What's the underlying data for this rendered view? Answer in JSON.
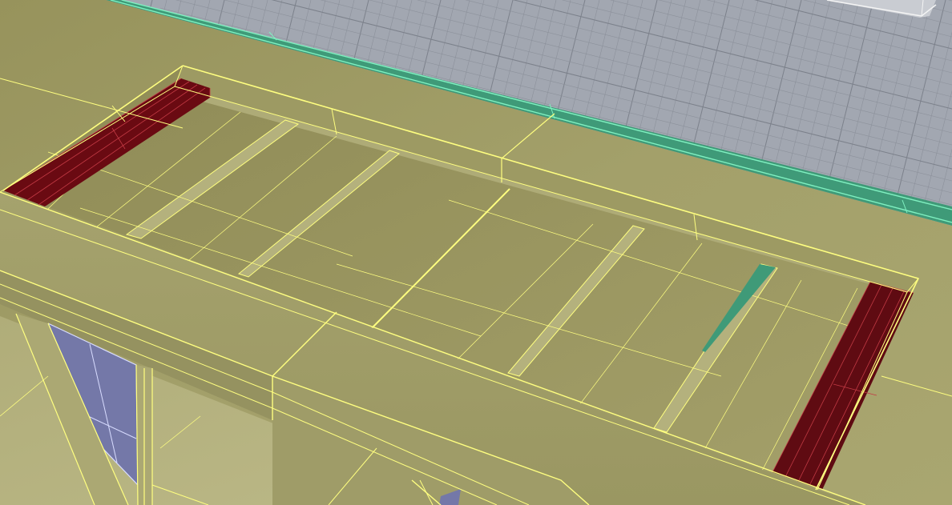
{
  "viewport": {
    "kind": "3d-modeling-viewport",
    "projection": "perspective",
    "display_mode": "shaded-with-wireframe-edges",
    "selection_state": "all-visible-geometry-selected"
  },
  "colors": {
    "ground_plane": "#a2a7b1",
    "grid_line": "#8c919b",
    "grid_major_line": "#7c818b",
    "selected_surface": "#a4a16a",
    "selected_surface_dark": "#8f8b57",
    "selected_surface_light": "#b4b17d",
    "selected_edge": "#ffff80",
    "highlight_face_red": "#6a0a12",
    "highlight_face_red_edge": "#c23a44",
    "glass_panel": "#7478a8",
    "glass_panel_edge": "#d8dcff",
    "teal_edge_strip": "#3f9a78",
    "teal_edge_line": "#7ff0c0",
    "background_object": "#c9ccd2"
  },
  "objects": [
    {
      "name": "ground-grid",
      "type": "construction-plane",
      "selected": false
    },
    {
      "name": "slab-frame",
      "type": "polysurface",
      "selected": true
    },
    {
      "name": "end-block-left",
      "type": "polysurface",
      "highlight": "red",
      "selected": true
    },
    {
      "name": "end-block-right",
      "type": "polysurface",
      "highlight": "red",
      "selected": true
    },
    {
      "name": "glass-panel",
      "type": "surface",
      "selected": false
    },
    {
      "name": "slab-edge-strip",
      "type": "polysurface",
      "selected": false
    },
    {
      "name": "background-box",
      "type": "polysurface",
      "selected": false
    }
  ]
}
